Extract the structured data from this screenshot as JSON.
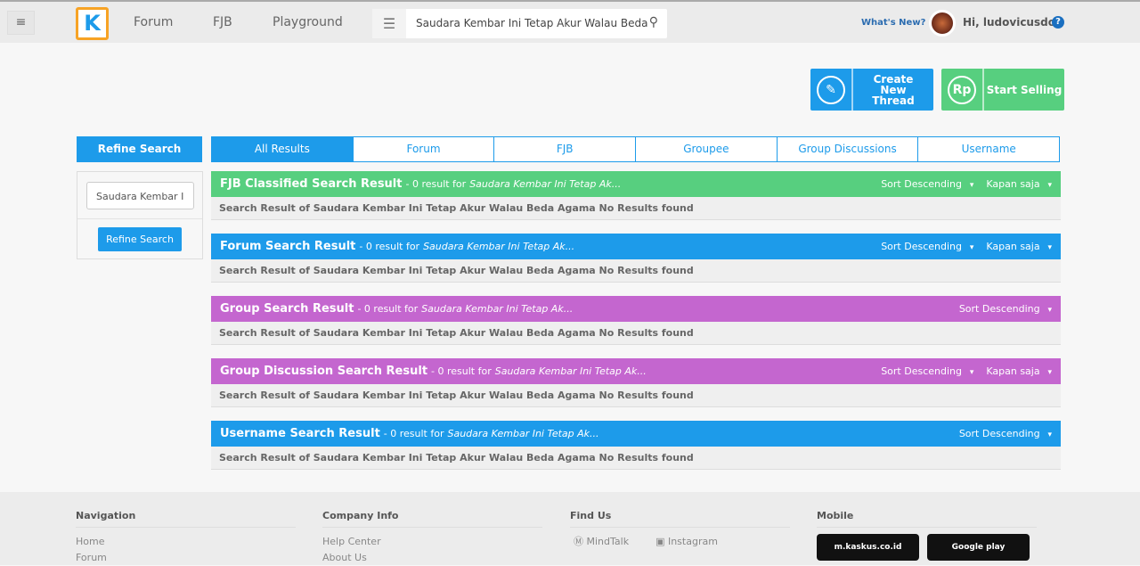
{
  "header": {
    "nav": [
      "Forum",
      "FJB",
      "Playground"
    ],
    "search_value": "Saudara Kembar Ini Tetap Akur Walau Beda",
    "whats_new": "What's New?",
    "greeting": "Hi, ludovicusdo",
    "help": "?",
    "logo": "K"
  },
  "actions": {
    "create": "Create New Thread",
    "sell": "Start Selling",
    "rp": "Rp"
  },
  "refine": {
    "title": "Refine Search",
    "input_value": "Saudara Kembar I",
    "button": "Refine Search"
  },
  "tabs": [
    "All Results",
    "Forum",
    "FJB",
    "Groupee",
    "Group Discussions",
    "Username"
  ],
  "colors": {
    "blue": "#1d9bea",
    "green": "#57cf7f",
    "purple": "#c466cf"
  },
  "sections": [
    {
      "title": "FJB Classified Search Result",
      "count": "- 0 result for",
      "query": "Saudara Kembar Ini Tetap Ak...",
      "sort": "Sort Descending",
      "time": "Kapan saja",
      "body": "Search Result of Saudara Kembar Ini Tetap Akur Walau Beda Agama No Results found",
      "color": "#57cf7f"
    },
    {
      "title": "Forum Search Result",
      "count": "- 0 result for",
      "query": "Saudara Kembar Ini Tetap Ak...",
      "sort": "Sort Descending",
      "time": "Kapan saja",
      "body": "Search Result of Saudara Kembar Ini Tetap Akur Walau Beda Agama No Results found",
      "color": "#1d9bea"
    },
    {
      "title": "Group Search Result",
      "count": "- 0 result for",
      "query": "Saudara Kembar Ini Tetap Ak...",
      "sort": "Sort Descending",
      "body": "Search Result of Saudara Kembar Ini Tetap Akur Walau Beda Agama No Results found",
      "color": "#c466cf"
    },
    {
      "title": "Group Discussion Search Result",
      "count": "- 0 result for",
      "query": "Saudara Kembar Ini Tetap Ak...",
      "sort": "Sort Descending",
      "time": "Kapan saja",
      "body": "Search Result of Saudara Kembar Ini Tetap Akur Walau Beda Agama No Results found",
      "color": "#c466cf"
    },
    {
      "title": "Username Search Result",
      "count": "- 0 result for",
      "query": "Saudara Kembar Ini Tetap Ak...",
      "sort": "Sort Descending",
      "body": "Search Result of Saudara Kembar Ini Tetap Akur Walau Beda Agama No Results found",
      "color": "#1d9bea"
    }
  ],
  "footer": {
    "navigation": {
      "title": "Navigation",
      "links": [
        "Home",
        "Forum"
      ]
    },
    "company": {
      "title": "Company Info",
      "links": [
        "Help Center",
        "About Us"
      ]
    },
    "findus": {
      "title": "Find Us",
      "links": [
        "MindTalk",
        "Instagram"
      ]
    },
    "mobile": {
      "title": "Mobile",
      "apps": [
        "m.kaskus.co.id",
        "Google play"
      ]
    }
  }
}
